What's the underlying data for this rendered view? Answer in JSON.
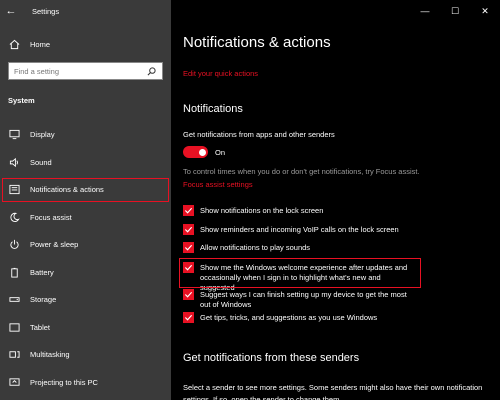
{
  "window": {
    "app_title": "Settings",
    "back_glyph": "←",
    "controls": [
      "—",
      "☐",
      "✕"
    ]
  },
  "sidebar": {
    "home_label": "Home",
    "search_placeholder": "Find a setting",
    "section_heading": "System",
    "items": [
      {
        "label": "Display",
        "icon": "display-icon"
      },
      {
        "label": "Sound",
        "icon": "sound-icon"
      },
      {
        "label": "Notifications & actions",
        "icon": "notifications-icon",
        "selected": true
      },
      {
        "label": "Focus assist",
        "icon": "moon-icon"
      },
      {
        "label": "Power & sleep",
        "icon": "power-icon"
      },
      {
        "label": "Battery",
        "icon": "battery-icon"
      },
      {
        "label": "Storage",
        "icon": "storage-icon"
      },
      {
        "label": "Tablet",
        "icon": "tablet-icon"
      },
      {
        "label": "Multitasking",
        "icon": "multitasking-icon"
      },
      {
        "label": "Projecting to this PC",
        "icon": "projecting-icon"
      }
    ]
  },
  "main": {
    "title": "Notifications & actions",
    "quick_actions_link": "Edit your quick actions",
    "notifications_heading": "Notifications",
    "get_notifications_label": "Get notifications from apps and other senders",
    "toggle_state": "On",
    "focus_text": "To control times when you do or don't get notifications, try Focus assist.",
    "focus_link": "Focus assist settings",
    "checkboxes": [
      {
        "label": "Show notifications on the lock screen",
        "checked": true
      },
      {
        "label": "Show reminders and incoming VoIP calls on the lock screen",
        "checked": true
      },
      {
        "label": "Allow notifications to play sounds",
        "checked": true
      },
      {
        "label": "Show me the Windows welcome experience after updates and occasionally when I sign in to highlight what's new and suggested",
        "checked": true
      },
      {
        "label": "Suggest ways I can finish setting up my device to get the most out of Windows",
        "checked": true
      },
      {
        "label": "Get tips, tricks, and suggestions as you use Windows",
        "checked": true
      }
    ],
    "senders_heading": "Get notifications from these senders",
    "senders_desc": "Select a sender to see more settings. Some senders might also have their own notification settings. If so, open the sender to change them."
  },
  "colors": {
    "accent": "#e81123",
    "sidebar_bg": "#3a3a3a",
    "main_bg": "#000000"
  }
}
